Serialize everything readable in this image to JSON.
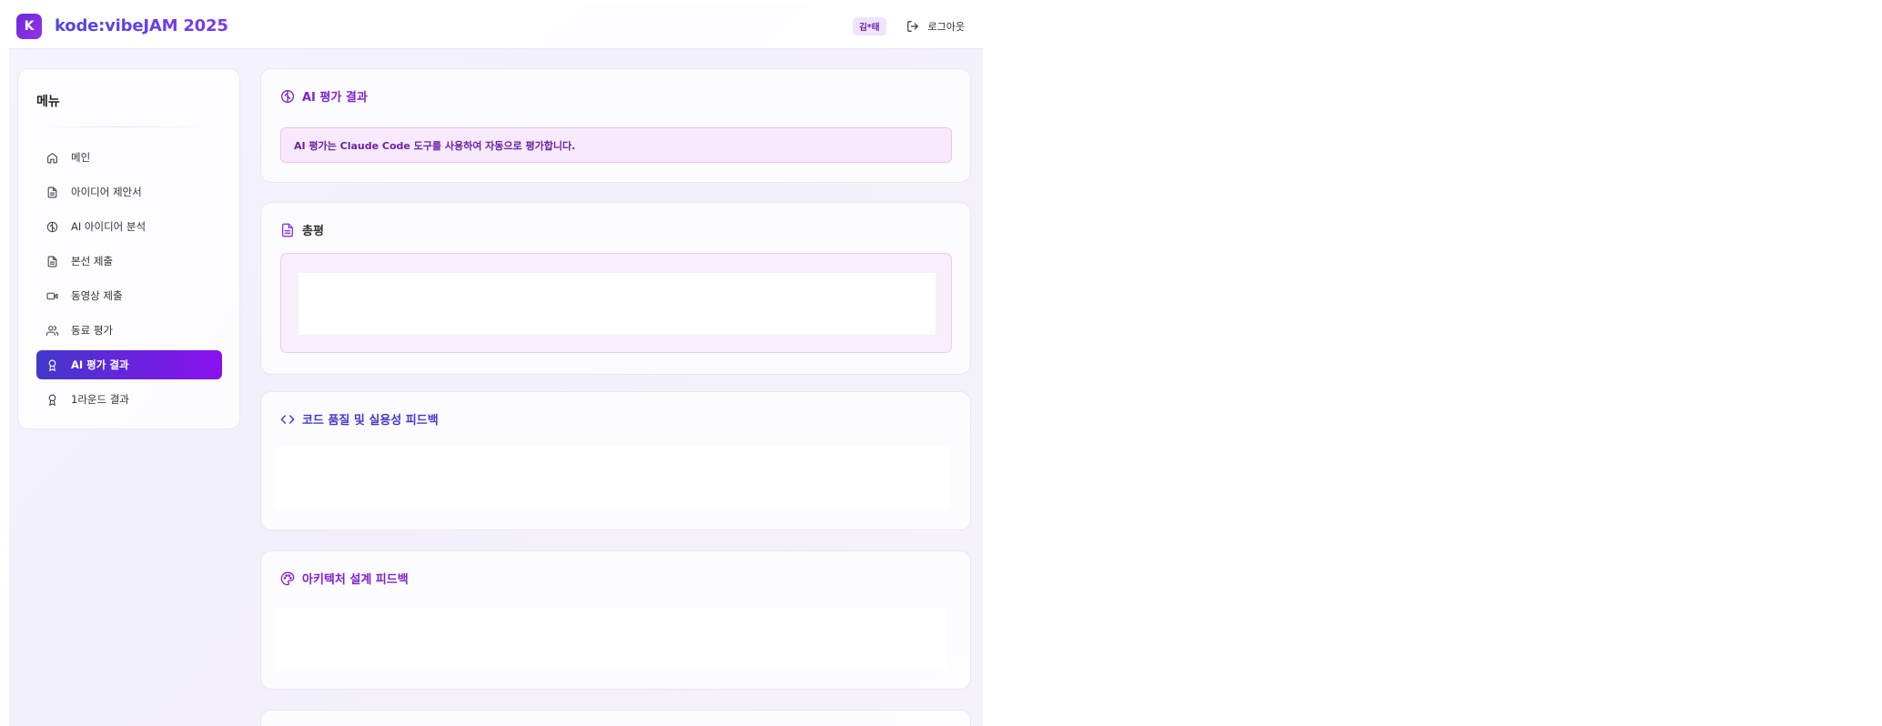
{
  "header": {
    "logo_letter": "K",
    "brand": "kode:vibeJAM 2025",
    "user_badge": "김*태",
    "logout_label": "로그아웃"
  },
  "sidebar": {
    "title": "메뉴",
    "items": [
      {
        "label": "메인",
        "icon": "home-icon",
        "active": false
      },
      {
        "label": "아이디어 제안서",
        "icon": "document-icon",
        "active": false
      },
      {
        "label": "AI 아이디어 분석",
        "icon": "brain-icon",
        "active": false
      },
      {
        "label": "본선 제출",
        "icon": "document-icon",
        "active": false
      },
      {
        "label": "동영상 제출",
        "icon": "video-icon",
        "active": false
      },
      {
        "label": "동료 평가",
        "icon": "users-icon",
        "active": false
      },
      {
        "label": "AI 평가 결과",
        "icon": "award-icon",
        "active": true
      },
      {
        "label": "1라운드 결과",
        "icon": "award-icon",
        "active": false
      }
    ]
  },
  "main": {
    "evaluation_card": {
      "title": "AI 평가 결과",
      "notice": "AI 평가는 Claude Code 도구를 사용하여 자동으로 평가합니다."
    },
    "summary_card": {
      "title": "총평"
    },
    "code_quality_card": {
      "title": "코드 품질 및 실용성 피드백"
    },
    "architecture_card": {
      "title": "아키텍처 설계 피드백"
    }
  },
  "colors": {
    "accent": "#7c3aed",
    "active_gradient_start": "#4338ca",
    "active_gradient_end": "#8b10ef"
  }
}
